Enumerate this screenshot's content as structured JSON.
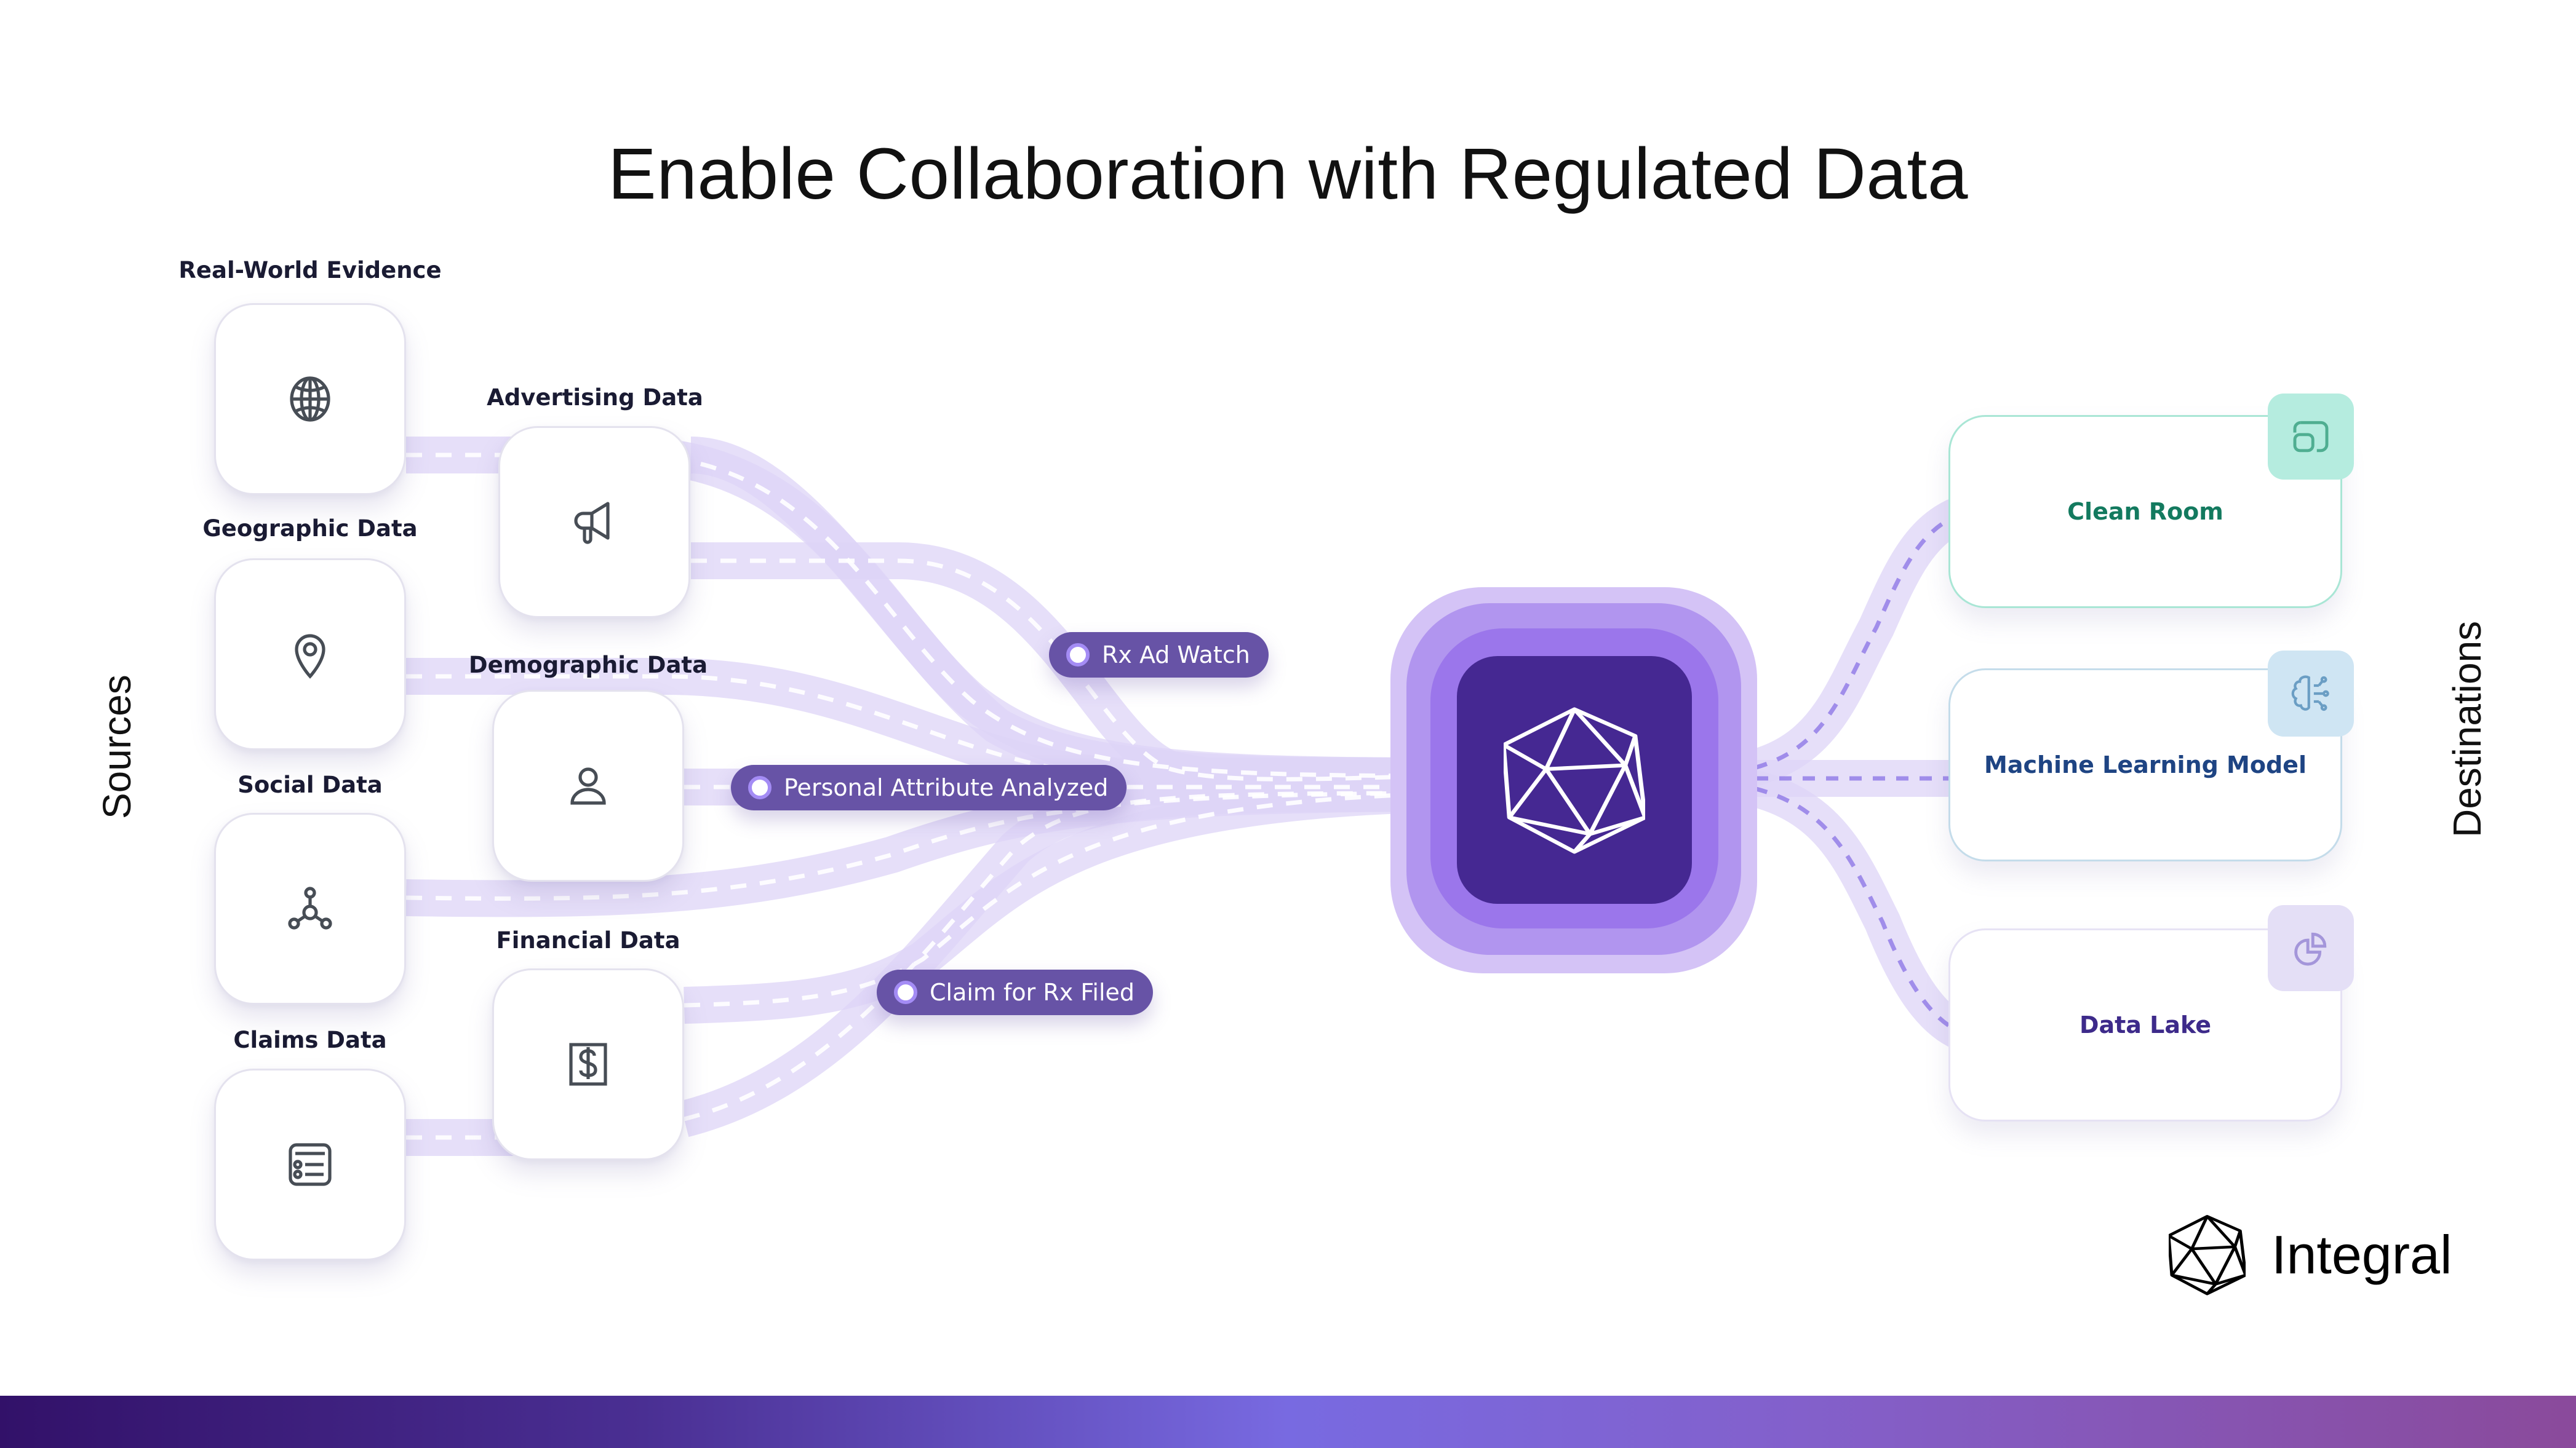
{
  "title": "Enable Collaboration with Regulated Data",
  "side_labels": {
    "sources": "Sources",
    "destinations": "Destinations"
  },
  "sources": [
    {
      "label": "Real-World Evidence",
      "icon": "globe-icon"
    },
    {
      "label": "Geographic Data",
      "icon": "map-pin-icon"
    },
    {
      "label": "Social Data",
      "icon": "network-icon"
    },
    {
      "label": "Claims Data",
      "icon": "list-card-icon"
    },
    {
      "label": "Advertising Data",
      "icon": "megaphone-icon"
    },
    {
      "label": "Demographic Data",
      "icon": "user-icon"
    },
    {
      "label": "Financial Data",
      "icon": "dollar-icon"
    }
  ],
  "events": [
    {
      "label": "Rx Ad Watch"
    },
    {
      "label": "Personal Attribute Analyzed"
    },
    {
      "label": "Claim for Rx Filed"
    }
  ],
  "hub": {
    "icon": "icosahedron-icon"
  },
  "destinations": [
    {
      "label": "Clean Room",
      "icon": "clean-room-icon",
      "color": "#137a5f",
      "border": "#a9e6d5",
      "badge_bg": "#b5ecdf",
      "icon_color": "#4fae91"
    },
    {
      "label": "Machine Learning Model",
      "icon": "brain-circuit-icon",
      "color": "#1e4483",
      "border": "#c4dcea",
      "badge_bg": "#cfe5f3",
      "icon_color": "#6b9ec4"
    },
    {
      "label": "Data Lake",
      "icon": "pie-chart-icon",
      "color": "#3d2a8a",
      "border": "#e6e2f4",
      "badge_bg": "#e4dff6",
      "icon_color": "#a496da"
    }
  ],
  "brand": {
    "name": "Integral",
    "logo_icon": "icosahedron-icon"
  },
  "colors": {
    "flow": "#d9d0f6",
    "pill": "#6753a6",
    "hub_core": "#452892",
    "bar_start": "#321169",
    "bar_mid": "#786ae1",
    "bar_end": "#8a4a9b"
  }
}
